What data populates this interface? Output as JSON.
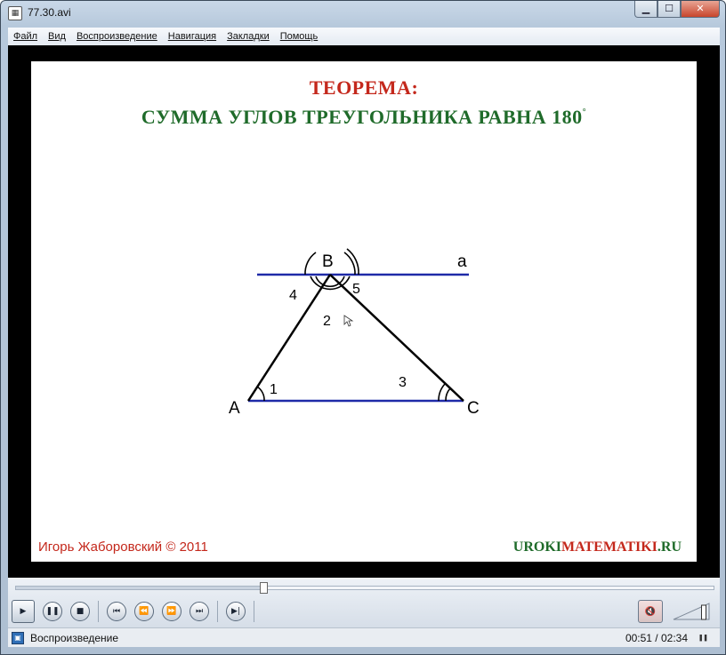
{
  "window": {
    "title": "77.30.avi",
    "buttons": {
      "minimize": "▁",
      "maximize": "☐",
      "close": "✕"
    }
  },
  "menu": [
    "Файл",
    "Вид",
    "Воспроизведение",
    "Навигация",
    "Закладки",
    "Помощь"
  ],
  "slide": {
    "title": "ТЕОРЕМА:",
    "subtitle": "СУММА УГЛОВ ТРЕУГОЛЬНИКА РАВНА 180",
    "degree": "°",
    "points": {
      "A": "A",
      "B": "B",
      "C": "C",
      "line": "a"
    },
    "angles": [
      "1",
      "2",
      "3",
      "4",
      "5"
    ],
    "author": "Игорь Жаборовский © 2011",
    "site_part1": "UROKI",
    "site_part2": "MATEMATIKI",
    "site_part3": ".RU",
    "colors": {
      "title": "#c4281c",
      "subtitle": "#1f6b2a",
      "parallel_line": "#1f2aa8",
      "triangle": "#000000"
    }
  },
  "player": {
    "progress": 0.355,
    "controls": [
      "play-icon",
      "pause-icon",
      "stop-icon",
      "skip-back-icon",
      "rewind-icon",
      "fast-forward-icon",
      "skip-forward-icon",
      "frame-step-icon"
    ],
    "muted": true,
    "volume": 0.85
  },
  "status": {
    "text": "Воспроизведение",
    "time": "00:51 / 02:34"
  }
}
